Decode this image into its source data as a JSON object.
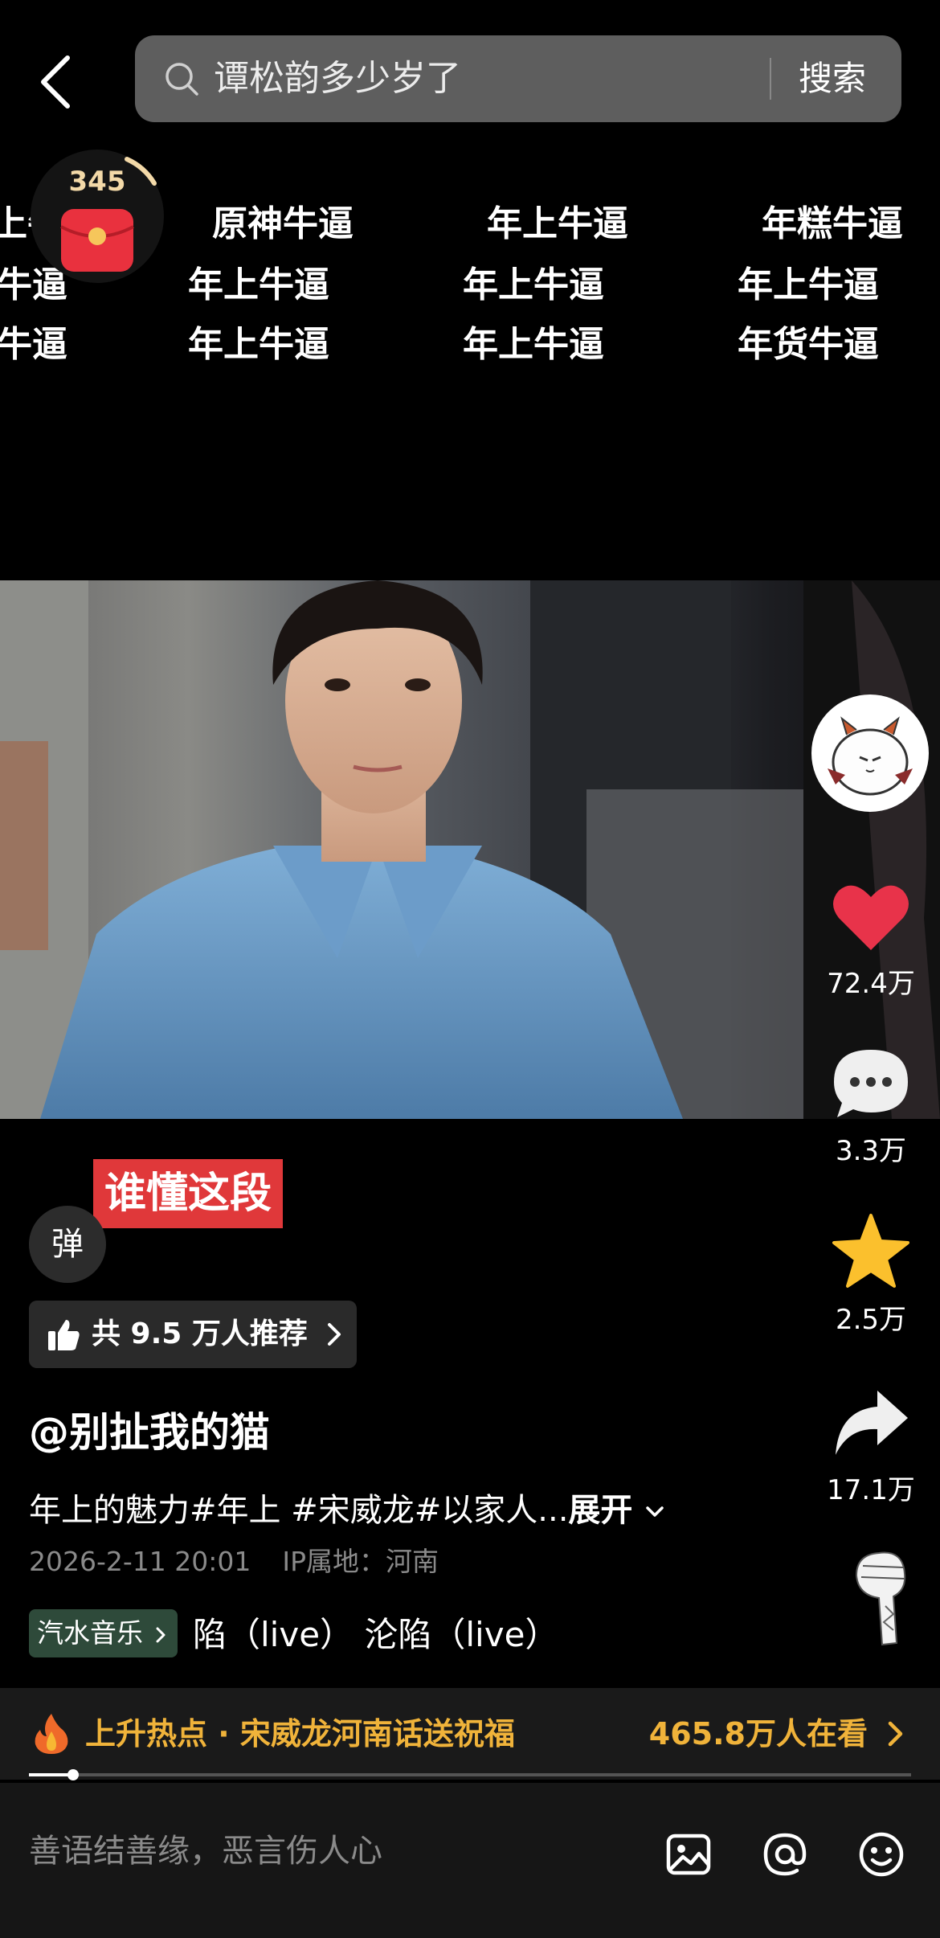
{
  "search": {
    "query": "谭松韵多少岁了",
    "button": "搜索"
  },
  "danmaku": {
    "row1": [
      "上牛逼",
      "原神牛逼",
      "年上牛逼",
      "年糕牛逼"
    ],
    "row2": [
      "牛逼",
      "年上牛逼",
      "年上牛逼",
      "年上牛逼"
    ],
    "row3": [
      "牛逼",
      "年上牛逼",
      "年上牛逼",
      "年货牛逼"
    ]
  },
  "red_packet": {
    "count": "345"
  },
  "actions": {
    "likes": "72.4万",
    "comments": "3.3万",
    "favorites": "2.5万",
    "shares": "17.1万"
  },
  "video": {
    "sticker_text": "谁懂这段"
  },
  "danmu_toggle": "弹",
  "recommend": {
    "text": "共 9.5 万人推荐"
  },
  "author": "@别扯我的猫",
  "caption": {
    "text": "年上的魅力#年上 #宋威龙#以家人...",
    "more": "展开"
  },
  "meta": {
    "date": "2026-2-11 20:01",
    "ip": "IP属地：河南"
  },
  "music": {
    "tag": "汽水音乐",
    "scroll": "陷（live）    沦陷（live）"
  },
  "hot": {
    "label": "上升热点 · 宋威龙河南话送祝福",
    "watching": "465.8万人在看"
  },
  "progress": {
    "fraction": 0.05
  },
  "comment": {
    "placeholder": "善语结善缘，恶言伤人心"
  },
  "colors": {
    "accent_gold": "#f0b33a",
    "like_red": "#e8334a",
    "star_yellow": "#fbc02d",
    "sticker_red": "#e0383a"
  }
}
